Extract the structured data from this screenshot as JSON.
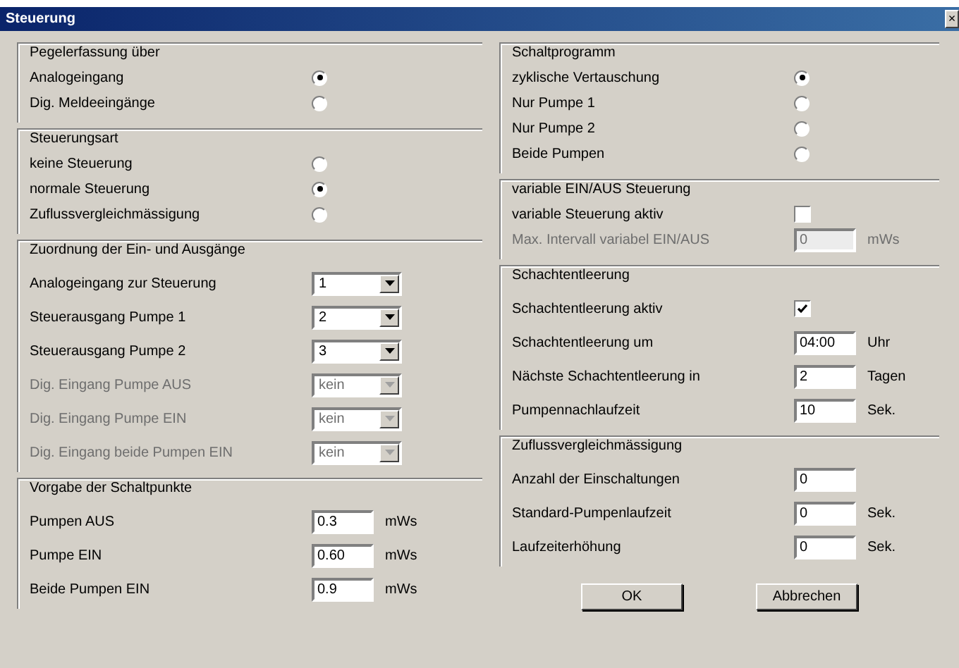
{
  "window": {
    "title": "Steuerung",
    "close": "×"
  },
  "left_groups": [
    {
      "title": "Pegelerfassung über",
      "rows": [
        {
          "kind": "radio",
          "label": "Analogeingang",
          "selected": true,
          "disabled": false
        },
        {
          "kind": "radio",
          "label": "Dig. Meldeeingänge",
          "selected": false,
          "disabled": false
        }
      ]
    },
    {
      "title": "Steuerungsart",
      "rows": [
        {
          "kind": "radio",
          "label": "keine Steuerung",
          "selected": false,
          "disabled": false
        },
        {
          "kind": "radio",
          "label": "normale Steuerung",
          "selected": true,
          "disabled": false
        },
        {
          "kind": "radio",
          "label": "Zuflussvergleichmässigung",
          "selected": false,
          "disabled": false
        }
      ]
    },
    {
      "title": "Zuordnung der Ein- und Ausgänge",
      "rows": [
        {
          "kind": "select",
          "label": "Analogeingang zur Steuerung",
          "value": "1",
          "disabled": false
        },
        {
          "kind": "select",
          "label": "Steuerausgang Pumpe 1",
          "value": "2",
          "disabled": false
        },
        {
          "kind": "select",
          "label": "Steuerausgang Pumpe 2",
          "value": "3",
          "disabled": false
        },
        {
          "kind": "select",
          "label": "Dig. Eingang Pumpe AUS",
          "value": "kein",
          "disabled": true
        },
        {
          "kind": "select",
          "label": "Dig. Eingang Pumpe EIN",
          "value": "kein",
          "disabled": true
        },
        {
          "kind": "select",
          "label": "Dig. Eingang beide Pumpen EIN",
          "value": "kein",
          "disabled": true
        }
      ]
    },
    {
      "title": "Vorgabe der Schaltpunkte",
      "rows": [
        {
          "kind": "input",
          "label": "Pumpen AUS",
          "value": "0.3",
          "unit": "mWs",
          "disabled": false
        },
        {
          "kind": "input",
          "label": "Pumpe EIN",
          "value": "0.60",
          "unit": "mWs",
          "disabled": false
        },
        {
          "kind": "input",
          "label": "Beide Pumpen EIN",
          "value": "0.9",
          "unit": "mWs",
          "disabled": false
        }
      ]
    }
  ],
  "right_groups": [
    {
      "title": "Schaltprogramm",
      "rows": [
        {
          "kind": "radio",
          "label": "zyklische Vertauschung",
          "selected": true,
          "disabled": false
        },
        {
          "kind": "radio",
          "label": "Nur Pumpe 1",
          "selected": false,
          "disabled": false
        },
        {
          "kind": "radio",
          "label": "Nur Pumpe 2",
          "selected": false,
          "disabled": false
        },
        {
          "kind": "radio",
          "label": "Beide Pumpen",
          "selected": false,
          "disabled": false
        }
      ]
    },
    {
      "title": "variable EIN/AUS Steuerung",
      "rows": [
        {
          "kind": "checkbox",
          "label": "variable Steuerung aktiv",
          "checked": false,
          "disabled": false
        },
        {
          "kind": "input",
          "label": "Max. Intervall variabel EIN/AUS",
          "value": "0",
          "unit": "mWs",
          "disabled": true
        }
      ]
    },
    {
      "title": "Schachtentleerung",
      "rows": [
        {
          "kind": "checkbox",
          "label": "Schachtentleerung aktiv",
          "checked": true,
          "disabled": false
        },
        {
          "kind": "input",
          "label": "Schachtentleerung um",
          "value": "04:00",
          "unit": "Uhr",
          "disabled": false
        },
        {
          "kind": "input",
          "label": "Nächste Schachtentleerung in",
          "value": "2",
          "unit": "Tagen",
          "disabled": false
        },
        {
          "kind": "input",
          "label": "Pumpennachlaufzeit",
          "value": "10",
          "unit": "Sek.",
          "disabled": false
        }
      ]
    },
    {
      "title": "Zuflussvergleichmässigung",
      "rows": [
        {
          "kind": "input",
          "label": "Anzahl der Einschaltungen",
          "value": "0",
          "disabled": false
        },
        {
          "kind": "input",
          "label": "Standard-Pumpenlaufzeit",
          "value": "0",
          "unit": "Sek.",
          "disabled": false
        },
        {
          "kind": "input",
          "label": "Laufzeiterhöhung",
          "value": "0",
          "unit": "Sek.",
          "disabled": false
        }
      ]
    }
  ],
  "buttons": [
    "OK",
    "Abbrechen"
  ]
}
